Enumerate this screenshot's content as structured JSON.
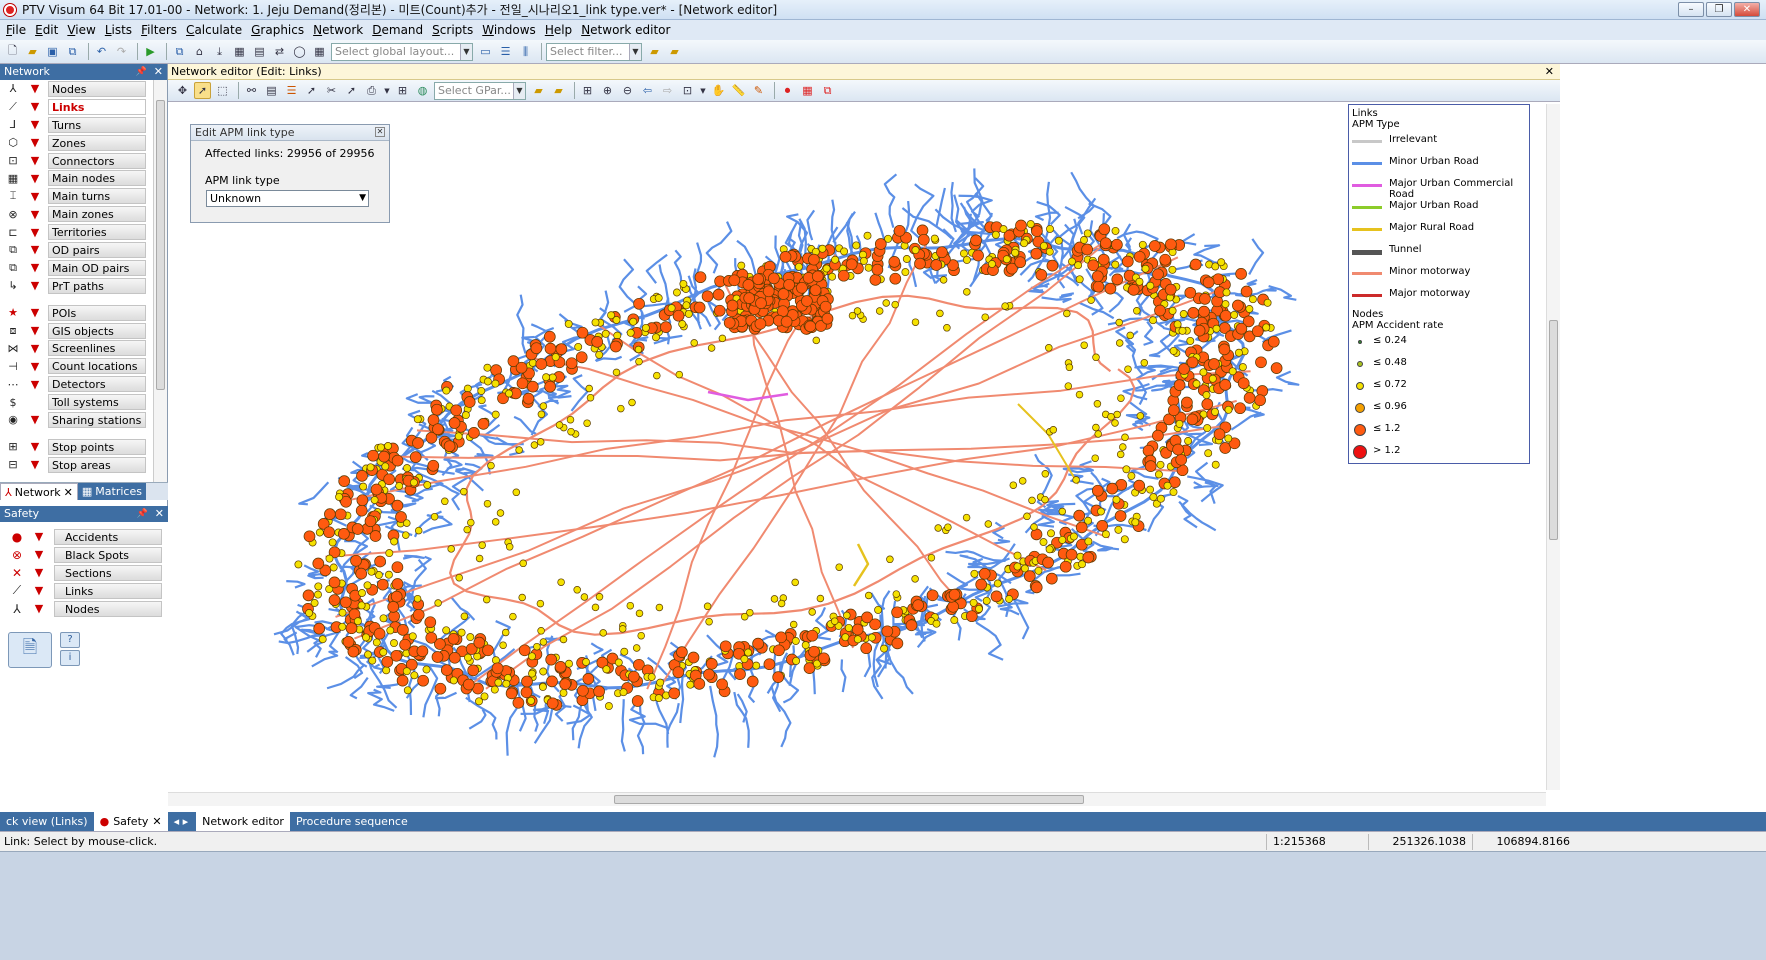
{
  "window": {
    "title": "PTV Visum 64 Bit 17.01-00 - Network: 1. Jeju Demand(정리본) - 미트(Count)추가 - 전일_시나리오1_link type.ver* - [Network editor]",
    "minimize": "–",
    "restore": "❐",
    "close": "✕"
  },
  "menu": [
    "File",
    "Edit",
    "View",
    "Lists",
    "Filters",
    "Calculate",
    "Graphics",
    "Network",
    "Demand",
    "Scripts",
    "Windows",
    "Help",
    "Network editor"
  ],
  "toolbar": {
    "layout_placeholder": "Select global layout...",
    "filter_placeholder": "Select filter..."
  },
  "network_panel": {
    "title": "Network",
    "items": [
      {
        "label": "Nodes",
        "icon": "⅄"
      },
      {
        "label": "Links",
        "icon": "⟋",
        "active": true
      },
      {
        "label": "Turns",
        "icon": "⅃"
      },
      {
        "label": "Zones",
        "icon": "⬡"
      },
      {
        "label": "Connectors",
        "icon": "⊡"
      },
      {
        "label": "Main nodes",
        "icon": "▦"
      },
      {
        "label": "Main turns",
        "icon": "⌶"
      },
      {
        "label": "Main zones",
        "icon": "⊗"
      },
      {
        "label": "Territories",
        "icon": "⊏"
      },
      {
        "label": "OD pairs",
        "icon": "⧉"
      },
      {
        "label": "Main OD pairs",
        "icon": "⧉"
      },
      {
        "label": "PrT paths",
        "icon": "↳"
      }
    ],
    "items2": [
      {
        "label": "POIs",
        "icon": "★"
      },
      {
        "label": "GIS objects",
        "icon": "⧈"
      },
      {
        "label": "Screenlines",
        "icon": "⋈"
      },
      {
        "label": "Count locations",
        "icon": "⊣"
      },
      {
        "label": "Detectors",
        "icon": "⋯"
      },
      {
        "label": "Toll systems",
        "icon": "$"
      },
      {
        "label": "Sharing stations",
        "icon": "◉"
      }
    ],
    "items3": [
      {
        "label": "Stop points",
        "icon": "⊞"
      },
      {
        "label": "Stop areas",
        "icon": "⊟"
      }
    ],
    "tabs": [
      "Network",
      "Matrices"
    ]
  },
  "safety_panel": {
    "title": "Safety",
    "items": [
      {
        "label": "Accidents",
        "icon": "●"
      },
      {
        "label": "Black Spots",
        "icon": "⊗"
      },
      {
        "label": "Sections",
        "icon": "✕"
      },
      {
        "label": "Links",
        "icon": "⟋"
      },
      {
        "label": "Nodes",
        "icon": "⅄"
      }
    ]
  },
  "editor": {
    "header": "Network editor (Edit: Links)",
    "gpar_placeholder": "Select GPar..."
  },
  "dialog": {
    "title": "Edit APM link type",
    "affected": "Affected links: 29956 of 29956",
    "field_label": "APM link type",
    "field_value": "Unknown"
  },
  "legend": {
    "links_title": "Links",
    "links_subtitle": "APM Type",
    "link_types": [
      {
        "label": "Irrelevant",
        "color": "#c8c8c8"
      },
      {
        "label": "Minor Urban Road",
        "color": "#5b8fe6"
      },
      {
        "label": "Major Urban Commercial Road",
        "color": "#e05ce0"
      },
      {
        "label": "Major Urban Road",
        "color": "#8ccc2a"
      },
      {
        "label": "Major Rural Road",
        "color": "#e6c21e"
      },
      {
        "label": "Tunnel",
        "color": "#555555"
      },
      {
        "label": "Minor motorway",
        "color": "#f08a70"
      },
      {
        "label": "Major motorway",
        "color": "#cc2a2a"
      }
    ],
    "nodes_title": "Nodes",
    "nodes_subtitle": "APM Accident rate",
    "node_classes": [
      {
        "label": "≤ 0.24",
        "color": "#2e8b2e"
      },
      {
        "label": "≤ 0.48",
        "color": "#a8c020"
      },
      {
        "label": "≤ 0.72",
        "color": "#f5e100"
      },
      {
        "label": "≤ 0.96",
        "color": "#f5a000"
      },
      {
        "label": "≤ 1.2",
        "color": "#ff5a10"
      },
      {
        "label": "> 1.2",
        "color": "#ee1010"
      }
    ]
  },
  "bottom_tabs": [
    "ck view (Links)",
    "Safety",
    "Network editor",
    "Procedure sequence"
  ],
  "status": {
    "message": "Link: Select by mouse-click.",
    "scale": "1:215368",
    "x": "251326.1038",
    "y": "106894.8166"
  }
}
